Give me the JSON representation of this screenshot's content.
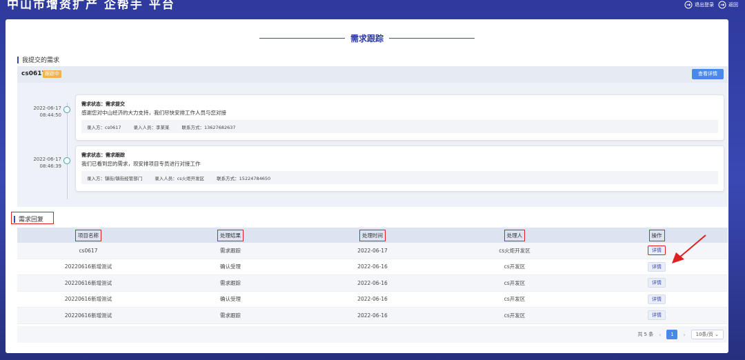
{
  "app": {
    "title": "中山市增资扩产 企帮手 平台",
    "logout_label": "退出登录",
    "back_label": "返回"
  },
  "page": {
    "heading": "需求跟踪",
    "submitted_section": "我提交的需求",
    "reply_section": "需求回复"
  },
  "demand": {
    "name": "cs0617",
    "status": "跟踪中",
    "detail_button": "查看详情",
    "timeline": [
      {
        "date": "2022-06-17",
        "time": "08:44:50",
        "status_label": "需求状态：",
        "status_value": "需求提交",
        "message": "感谢您对中山经济的大力支持，我们尽快安排工作人员与您对接",
        "meta": [
          {
            "label": "录入方：",
            "value": "cs0617"
          },
          {
            "label": "录入人员：",
            "value": "李某某"
          },
          {
            "label": "联系方式：",
            "value": "13627682637"
          }
        ]
      },
      {
        "date": "2022-06-17",
        "time": "08:46:39",
        "status_label": "需求状态：",
        "status_value": "需求跟踪",
        "message": "我们已看到您的需求，现安排项目专员进行对接工作",
        "meta": [
          {
            "label": "录入方：",
            "value": "镇街/镇街经管部门"
          },
          {
            "label": "录入人员：",
            "value": "cs火炬开发区"
          },
          {
            "label": "联系方式：",
            "value": "15224784650"
          }
        ]
      }
    ]
  },
  "reply_table": {
    "headers": [
      "项目名称",
      "处理结果",
      "处理时间",
      "处理人",
      "操作"
    ],
    "rows": [
      [
        "cs0617",
        "需求跟踪",
        "2022-06-17",
        "cs火炬开发区",
        "详情"
      ],
      [
        "20220616新增测试",
        "确认受理",
        "2022-06-16",
        "cs开发区",
        "详情"
      ],
      [
        "20220616新增测试",
        "需求跟踪",
        "2022-06-16",
        "cs开发区",
        "详情"
      ],
      [
        "20220616新增测试",
        "确认受理",
        "2022-06-16",
        "cs开发区",
        "详情"
      ],
      [
        "20220616新增测试",
        "需求跟踪",
        "2022-06-16",
        "cs开发区",
        "详情"
      ]
    ]
  },
  "pagination": {
    "total": "共 5 条",
    "prev": "‹",
    "current": "1",
    "next": "›",
    "page_size": "10条/页"
  },
  "colors": {
    "accent": "#3a48b4",
    "annotation": "#e02020",
    "status_badge": "#f2b24a",
    "primary_button": "#4a89e8"
  }
}
